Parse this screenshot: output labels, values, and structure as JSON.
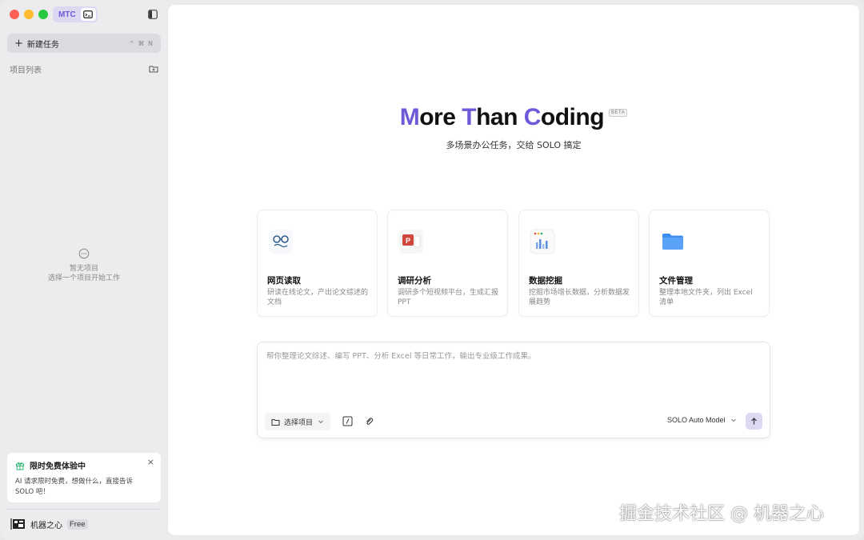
{
  "sidebar": {
    "brand_label": "MTC",
    "new_task_label": "新建任务",
    "new_task_shortcut": "^ ⌘ N",
    "project_list_label": "项目列表",
    "empty_title": "暂无项目",
    "empty_subtitle": "选择一个项目开始工作",
    "promo": {
      "title": "限时免费体验中",
      "text": "AI 请求限时免费，想做什么，直接告诉 SOLO 吧！",
      "close": "×"
    },
    "user": {
      "name": "机器之心",
      "plan": "Free"
    }
  },
  "hero": {
    "title_parts": [
      "M",
      "ore ",
      "T",
      "han ",
      "C",
      "oding"
    ],
    "badge": "BETA",
    "subtitle": "多场景办公任务，交给 SOLO 搞定"
  },
  "cards": [
    {
      "title": "网页读取",
      "desc": "研读在线论文，产出论文综述的文档",
      "icon": "glasses-icon"
    },
    {
      "title": "调研分析",
      "desc": "调研多个短视频平台，生成汇报 PPT",
      "icon": "ppt-icon"
    },
    {
      "title": "数据挖掘",
      "desc": "挖掘市场增长数据，分析数据发展趋势",
      "icon": "chart-icon"
    },
    {
      "title": "文件管理",
      "desc": "整理本地文件夹，列出 Excel 清单",
      "icon": "folder-icon"
    }
  ],
  "composer": {
    "placeholder": "帮你整理论文综述、编写 PPT、分析 Excel 等日常工作，输出专业级工作成果。",
    "choose_project_label": "选择项目",
    "model_label": "SOLO Auto Model"
  },
  "watermark": "掘金技术社区 @ 机器之心",
  "colors": {
    "accent": "#6e59d9",
    "accent_soft": "#dcd9f2",
    "sidebar_bg": "#ececee"
  }
}
